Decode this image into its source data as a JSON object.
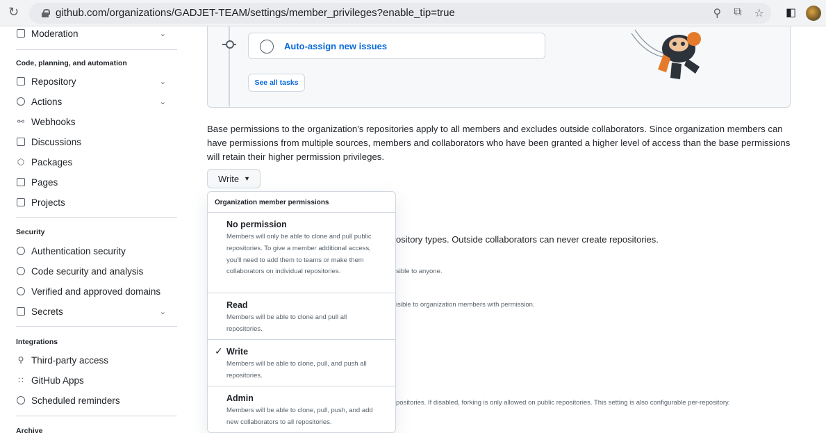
{
  "browser": {
    "url": "github.com/organizations/GADJET-TEAM/settings/member_privileges?enable_tip=true"
  },
  "sidebar": {
    "top_item": {
      "label": "Moderation"
    },
    "section_code": "Code, planning, and automation",
    "code_items": [
      {
        "label": "Repository"
      },
      {
        "label": "Actions"
      },
      {
        "label": "Webhooks"
      },
      {
        "label": "Discussions"
      },
      {
        "label": "Packages"
      },
      {
        "label": "Pages"
      },
      {
        "label": "Projects"
      }
    ],
    "section_security": "Security",
    "security_items": [
      {
        "label": "Authentication security"
      },
      {
        "label": "Code security and analysis"
      },
      {
        "label": "Verified and approved domains"
      },
      {
        "label": "Secrets"
      }
    ],
    "section_integrations": "Integrations",
    "integration_items": [
      {
        "label": "Third-party access"
      },
      {
        "label": "GitHub Apps"
      },
      {
        "label": "Scheduled reminders"
      }
    ],
    "section_archive": "Archive"
  },
  "onboarding": {
    "task_label": "Auto-assign new issues",
    "see_all_label": "See all tasks"
  },
  "main": {
    "base_permissions_desc": "Base permissions to the organization's repositories apply to all members and excludes outside collaborators. Since organization members can have permissions from multiple sources, members and collaborators who have been granted a higher level of access than the base permissions will retain their higher permission privileges.",
    "selected_permission": "Write",
    "behind_text_1": "ository types. Outside collaborators can never create repositories.",
    "behind_text_2": "sible to anyone.",
    "behind_text_3": "isible to organization members with permission.",
    "behind_text_4": "positories. If disabled, forking is only allowed on public repositories. This setting is also configurable per-repository."
  },
  "menu": {
    "header": "Organization member permissions",
    "items": [
      {
        "title": "No permission",
        "desc": "Members will only be able to clone and pull public repositories. To give a member additional access, you'll need to add them to teams or make them collaborators on individual repositories."
      },
      {
        "title": "Read",
        "desc": "Members will be able to clone and pull all repositories."
      },
      {
        "title": "Write",
        "desc": "Members will be able to clone, pull, and push all repositories."
      },
      {
        "title": "Admin",
        "desc": "Members will be able to clone, pull, push, and add new collaborators to all repositories."
      }
    ]
  }
}
